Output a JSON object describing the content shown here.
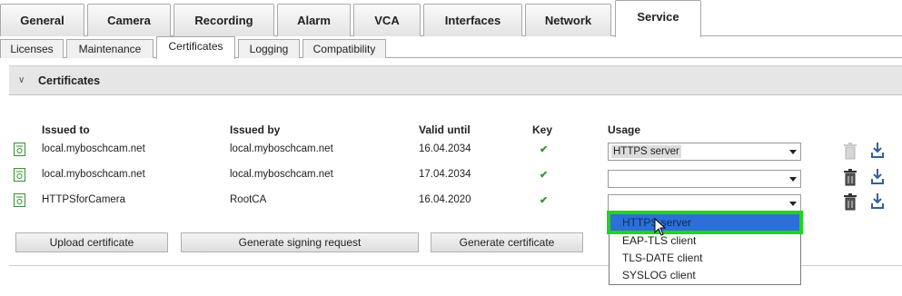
{
  "main_tabs": [
    "General",
    "Camera",
    "Recording",
    "Alarm",
    "VCA",
    "Interfaces",
    "Network",
    "Service"
  ],
  "sub_tabs": [
    "Licenses",
    "Maintenance",
    "Certificates",
    "Logging",
    "Compatibility"
  ],
  "section": {
    "title": "Certificates",
    "collapse_icon": "chevron-down-icon"
  },
  "columns": {
    "issued_to": "Issued to",
    "issued_by": "Issued by",
    "valid_until": "Valid until",
    "key": "Key",
    "usage": "Usage"
  },
  "rows": [
    {
      "issued_to": "local.myboschcam.net",
      "issued_by": "local.myboschcam.net",
      "valid_until": "16.04.2034",
      "key": "✔",
      "usage": "HTTPS server"
    },
    {
      "issued_to": "local.myboschcam.net",
      "issued_by": "local.myboschcam.net",
      "valid_until": "17.04.2034",
      "key": "✔",
      "usage": ""
    },
    {
      "issued_to": "HTTPSforCamera",
      "issued_by": "RootCA",
      "valid_until": "16.04.2020",
      "key": "✔",
      "usage": ""
    }
  ],
  "buttons": {
    "upload": "Upload certificate",
    "signing": "Generate signing request",
    "generate": "Generate certificate"
  },
  "dropdown_options": [
    "HTTPS server",
    "EAP-TLS client",
    "TLS-DATE client",
    "SYSLOG client"
  ],
  "colors": {
    "highlight": "#2d6fd6",
    "focus_outline": "#22d41e",
    "check": "#2e9b2e",
    "cert_icon": "#3a8f3a"
  }
}
